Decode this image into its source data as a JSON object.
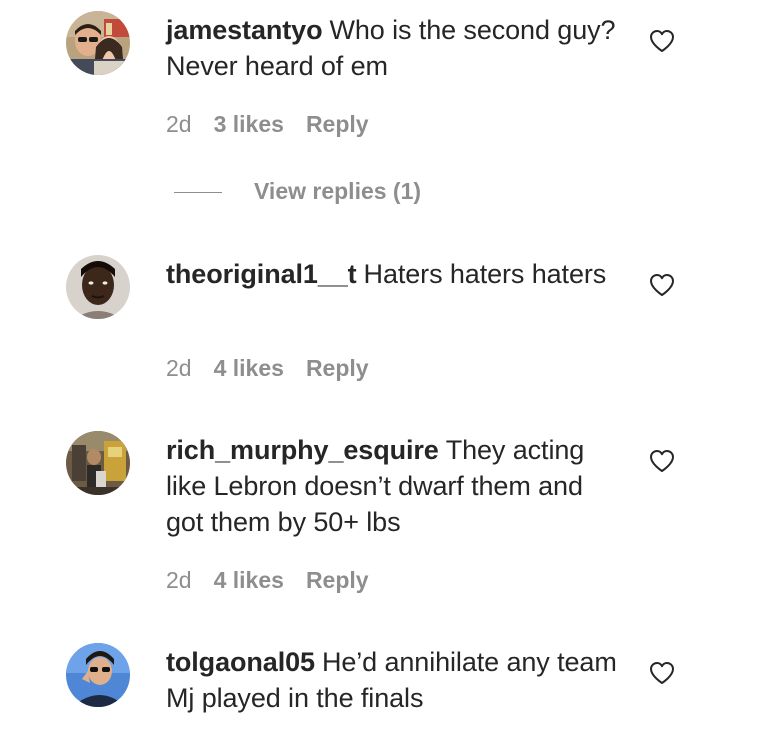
{
  "comments": [
    {
      "username": "jamestantyo",
      "text": "Who is the second guy? Never heard of em",
      "age": "2d",
      "likes": "3 likes",
      "reply_label": "Reply",
      "view_replies": "View replies (1)"
    },
    {
      "username": "theoriginal1__t",
      "text": "Haters haters haters",
      "age": "2d",
      "likes": "4 likes",
      "reply_label": "Reply"
    },
    {
      "username": "rich_murphy_esquire",
      "text": "They acting like Lebron doesn’t dwarf them and got them by 50+ lbs",
      "age": "2d",
      "likes": "4 likes",
      "reply_label": "Reply"
    },
    {
      "username": "tolgaonal05",
      "text": "He’d annihilate any team Mj played in the finals"
    }
  ],
  "icons": {
    "like": "heart-outline-icon"
  },
  "colors": {
    "text": "#262626",
    "secondary": "#8e8e8e",
    "background": "#ffffff"
  }
}
